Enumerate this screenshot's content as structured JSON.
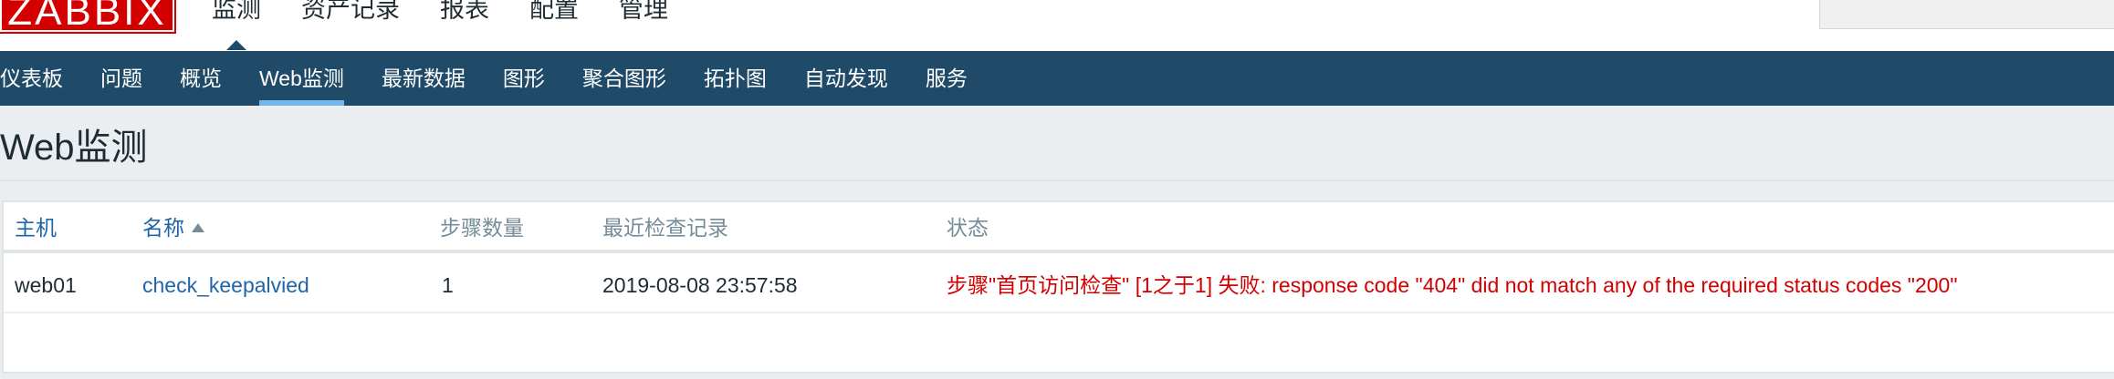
{
  "app": {
    "logo_text": "ZABBIX"
  },
  "main_menu": {
    "items": [
      {
        "label": "监测",
        "active": true
      },
      {
        "label": "资产记录",
        "active": false
      },
      {
        "label": "报表",
        "active": false
      },
      {
        "label": "配置",
        "active": false
      },
      {
        "label": "管理",
        "active": false
      }
    ]
  },
  "sub_menu": {
    "items": [
      {
        "label": "仪表板"
      },
      {
        "label": "问题"
      },
      {
        "label": "概览"
      },
      {
        "label": "Web监测",
        "active": true
      },
      {
        "label": "最新数据"
      },
      {
        "label": "图形"
      },
      {
        "label": "聚合图形"
      },
      {
        "label": "拓扑图"
      },
      {
        "label": "自动发现"
      },
      {
        "label": "服务"
      }
    ]
  },
  "page": {
    "title": "Web监测"
  },
  "table": {
    "headers": {
      "host": "主机",
      "name": "名称",
      "steps": "步骤数量",
      "last_check": "最近检查记录",
      "status": "状态"
    },
    "sort": {
      "column": "name",
      "direction": "asc"
    },
    "rows": [
      {
        "host": "web01",
        "name": "check_keepalvied",
        "steps": "1",
        "last_check": "2019-08-08 23:57:58",
        "status": "步骤\"首页访问检查\" [1之于1] 失败: response code \"404\" did not match any of the required status codes \"200\""
      }
    ]
  },
  "colors": {
    "brand_red": "#d40000",
    "nav_blue": "#1f4a68",
    "active_tab_accent": "#74b5ea",
    "link_blue": "#1f65a6",
    "error_red": "#d40000"
  }
}
